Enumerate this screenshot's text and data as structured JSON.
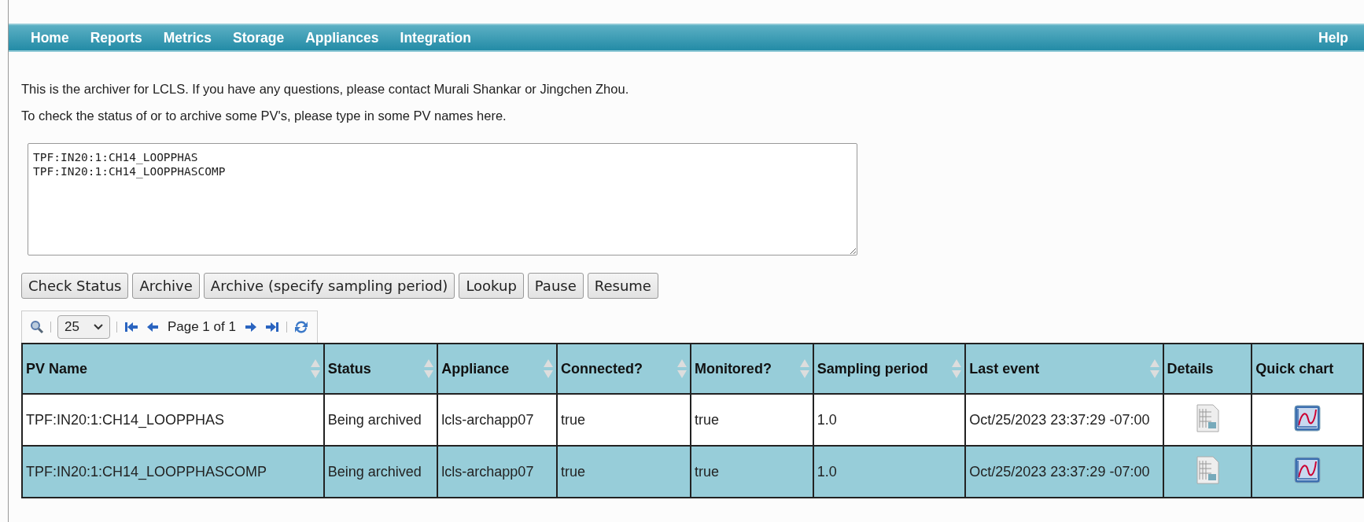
{
  "nav": {
    "items": [
      "Home",
      "Reports",
      "Metrics",
      "Storage",
      "Appliances",
      "Integration"
    ],
    "help": "Help"
  },
  "intro": [
    "This is the archiver for LCLS. If you have any questions, please contact Murali Shankar or Jingchen Zhou.",
    "To check the status of or to archive some PV's, please type in some PV names here."
  ],
  "pv_input": {
    "value": "TPF:IN20:1:CH14_LOOPPHAS\nTPF:IN20:1:CH14_LOOPPHASCOMP"
  },
  "buttons": [
    "Check Status",
    "Archive",
    "Archive (specify sampling period)",
    "Lookup",
    "Pause",
    "Resume"
  ],
  "pager": {
    "page_size": "25",
    "page_text": "Page 1 of 1"
  },
  "table": {
    "columns": [
      {
        "label": "PV Name",
        "sortable": true
      },
      {
        "label": "Status",
        "sortable": true
      },
      {
        "label": "Appliance",
        "sortable": true
      },
      {
        "label": "Connected?",
        "sortable": true
      },
      {
        "label": "Monitored?",
        "sortable": true
      },
      {
        "label": "Sampling period",
        "sortable": true
      },
      {
        "label": "Last event",
        "sortable": true
      },
      {
        "label": "Details",
        "sortable": false
      },
      {
        "label": "Quick chart",
        "sortable": false
      }
    ],
    "rows": [
      {
        "selected": false,
        "cells": [
          "TPF:IN20:1:CH14_LOOPPHAS",
          "Being archived",
          "lcls-archapp07",
          "true",
          "true",
          "1.0",
          "Oct/25/2023 23:37:29 -07:00"
        ]
      },
      {
        "selected": true,
        "cells": [
          "TPF:IN20:1:CH14_LOOPPHASCOMP",
          "Being archived",
          "lcls-archapp07",
          "true",
          "true",
          "1.0",
          "Oct/25/2023 23:37:29 -07:00"
        ]
      }
    ]
  }
}
